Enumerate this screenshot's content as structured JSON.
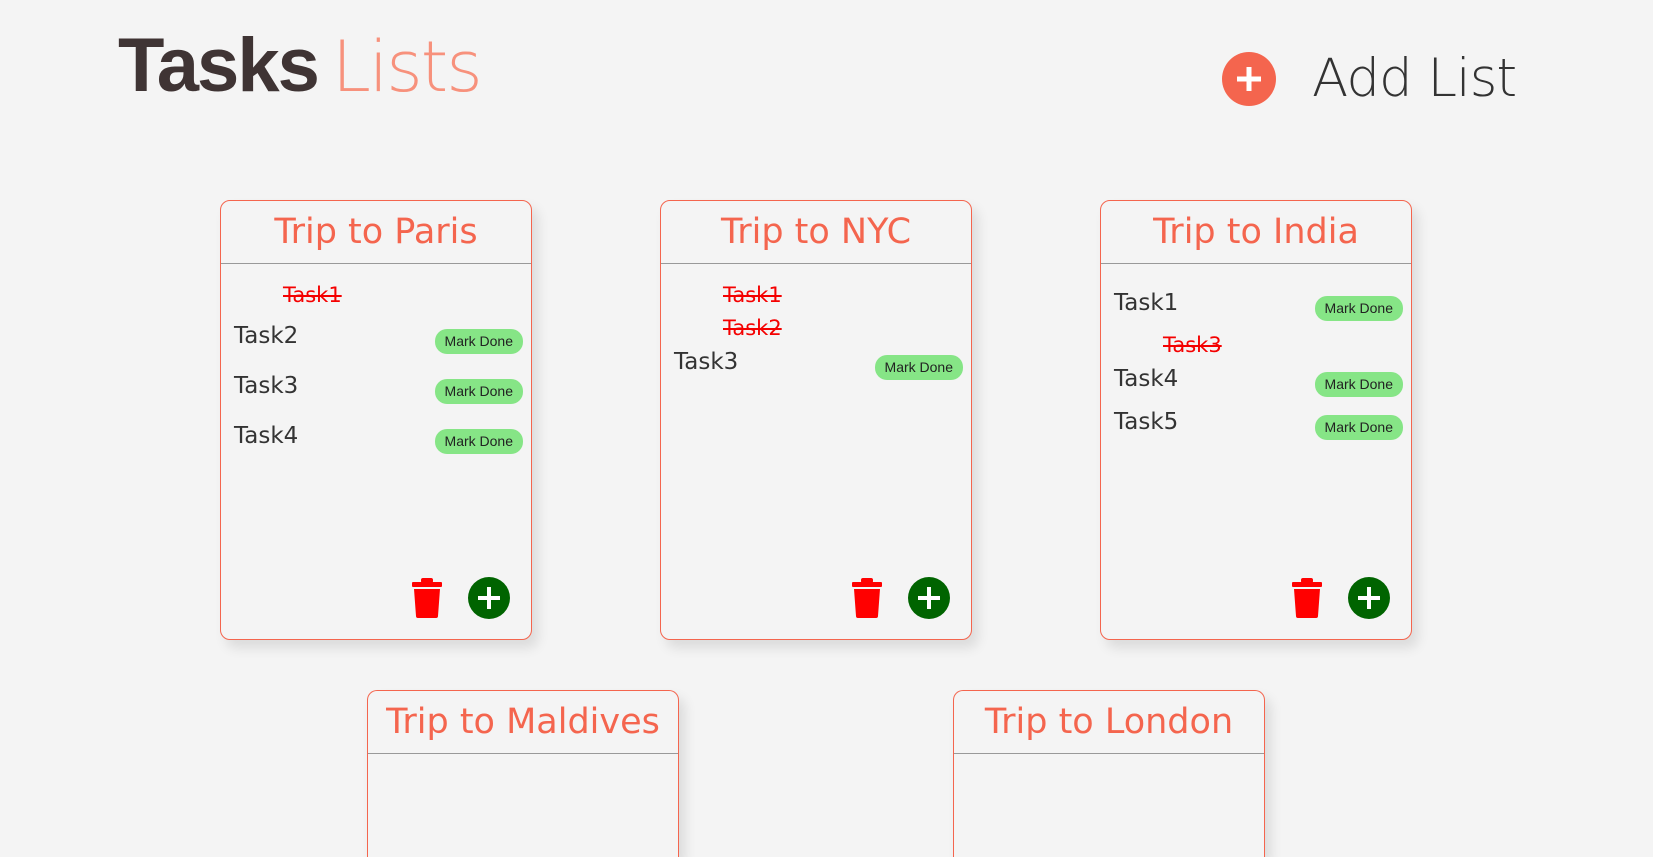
{
  "header": {
    "title_bold": "Tasks",
    "title_light": "Lists",
    "add_list_label": "Add List"
  },
  "colors": {
    "accent": "#f4654e",
    "done_text": "#f40000",
    "mark_done_bg": "#86e586",
    "add_task_bg": "#006400",
    "trash": "#ff0000"
  },
  "lists": [
    {
      "title": "Trip to Paris",
      "tasks": [
        {
          "name": "Task1",
          "done": true
        },
        {
          "name": "Task2",
          "done": false,
          "button": "Mark Done"
        },
        {
          "name": "Task3",
          "done": false,
          "button": "Mark Done"
        },
        {
          "name": "Task4",
          "done": false,
          "button": "Mark Done"
        }
      ]
    },
    {
      "title": "Trip to NYC",
      "tasks": [
        {
          "name": "Task1",
          "done": true
        },
        {
          "name": "Task2",
          "done": true
        },
        {
          "name": "Task3",
          "done": false,
          "button": "Mark Done"
        }
      ]
    },
    {
      "title": "Trip to India",
      "tasks": [
        {
          "name": "Task1",
          "done": false,
          "button": "Mark Done"
        },
        {
          "name": "Task3",
          "done": true
        },
        {
          "name": "Task4",
          "done": false,
          "button": "Mark Done"
        },
        {
          "name": "Task5",
          "done": false,
          "button": "Mark Done"
        }
      ]
    },
    {
      "title": "Trip to Maldives",
      "tasks": []
    },
    {
      "title": "Trip to London",
      "tasks": []
    }
  ]
}
